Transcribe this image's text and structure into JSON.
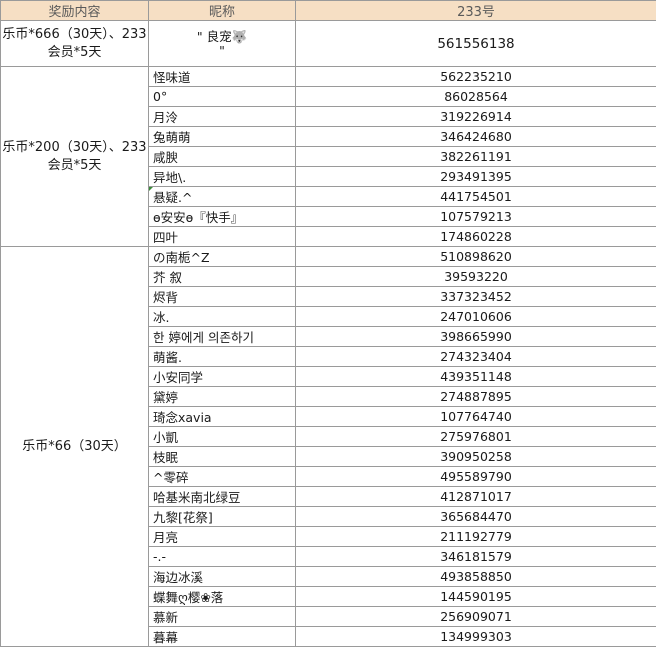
{
  "header": {
    "col_reward": "奖励内容",
    "col_nickname": "昵称",
    "col_id": "233号"
  },
  "groups": [
    {
      "reward": "乐币*666（30天）、233会员*5天",
      "rows": [
        {
          "nickname": "\" 良宠🐺\n\"",
          "id": "561556138"
        }
      ]
    },
    {
      "reward": "乐币*200（30天）、233会员*5天",
      "rows": [
        {
          "nickname": "怪味道",
          "id": "562235210"
        },
        {
          "nickname": "0°",
          "id": "86028564"
        },
        {
          "nickname": "月泠",
          "id": "319226914"
        },
        {
          "nickname": "兔萌萌",
          "id": "346424680"
        },
        {
          "nickname": "咸腴",
          "id": "382261191"
        },
        {
          "nickname": "异地\\.",
          "id": "293491395"
        },
        {
          "nickname": "悬疑.^",
          "id": "441754501"
        },
        {
          "nickname": "ɵ安安ɵ『快手』",
          "id": "107579213"
        },
        {
          "nickname": "四叶",
          "id": "174860228"
        }
      ]
    },
    {
      "reward": "乐币*66（30天）",
      "rows": [
        {
          "nickname": "の南栀^Z",
          "id": "510898620"
        },
        {
          "nickname": "芥 叙",
          "id": "39593220"
        },
        {
          "nickname": "烬背",
          "id": "337323452"
        },
        {
          "nickname": "冰.",
          "id": "247010606"
        },
        {
          "nickname": "한 婷에게 의존하기",
          "id": "398665990"
        },
        {
          "nickname": "萌酱.",
          "id": "274323404"
        },
        {
          "nickname": "小安同学",
          "id": "439351148"
        },
        {
          "nickname": "黛婷",
          "id": "274887895"
        },
        {
          "nickname": "琦念xavia",
          "id": "107764740"
        },
        {
          "nickname": "小凱",
          "id": "275976801"
        },
        {
          "nickname": "枝眠",
          "id": "390950258"
        },
        {
          "nickname": "^零碎",
          "id": "495589790"
        },
        {
          "nickname": "哈基米南北绿豆",
          "id": "412871017"
        },
        {
          "nickname": "九黎[花祭]",
          "id": "365684470"
        },
        {
          "nickname": "月亮",
          "id": "211192779"
        },
        {
          "nickname": "-.-",
          "id": "346181579"
        },
        {
          "nickname": "海边冰溪",
          "id": "493858850"
        },
        {
          "nickname": "蝶舞ღ樱❀落",
          "id": "144590195"
        },
        {
          "nickname": "慕新",
          "id": "256909071"
        },
        {
          "nickname": "暮幕",
          "id": "134999303"
        }
      ]
    }
  ]
}
